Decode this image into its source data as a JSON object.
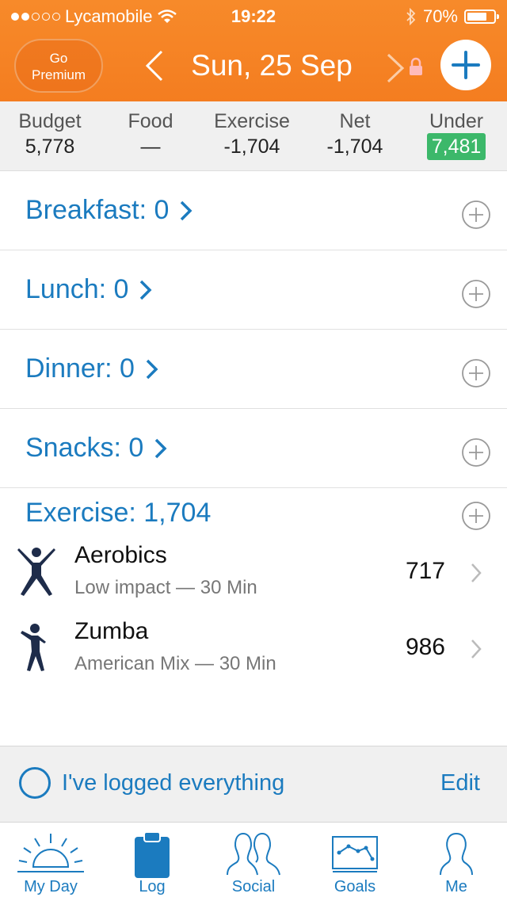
{
  "status_bar": {
    "carrier": "Lycamobile",
    "time": "19:22",
    "battery": "70%"
  },
  "header": {
    "premium_line1": "Go",
    "premium_line2": "Premium",
    "date": "Sun, 25 Sep"
  },
  "summary": [
    {
      "label": "Budget",
      "value": "5,778"
    },
    {
      "label": "Food",
      "value": "—"
    },
    {
      "label": "Exercise",
      "value": "-1,704"
    },
    {
      "label": "Net",
      "value": "-1,704"
    },
    {
      "label": "Under",
      "value": "7,481"
    }
  ],
  "meals": [
    {
      "label": "Breakfast: 0"
    },
    {
      "label": "Lunch: 0"
    },
    {
      "label": "Dinner: 0"
    },
    {
      "label": "Snacks: 0"
    }
  ],
  "exercise": {
    "title": "Exercise: 1,704",
    "items": [
      {
        "name": "Aerobics",
        "detail": "Low impact — 30 Min",
        "calories": "717"
      },
      {
        "name": "Zumba",
        "detail": "American Mix — 30 Min",
        "calories": "986"
      }
    ]
  },
  "footer": {
    "logged_label": "I've logged everything",
    "edit_label": "Edit"
  },
  "tabs": [
    {
      "label": "My Day",
      "icon": "sunrise-icon"
    },
    {
      "label": "Log",
      "icon": "clipboard-icon"
    },
    {
      "label": "Social",
      "icon": "people-icon"
    },
    {
      "label": "Goals",
      "icon": "chart-icon"
    },
    {
      "label": "Me",
      "icon": "person-icon"
    }
  ],
  "colors": {
    "header": "#f47d20",
    "accent": "#1b7bbf",
    "under_badge": "#3cb86a"
  }
}
